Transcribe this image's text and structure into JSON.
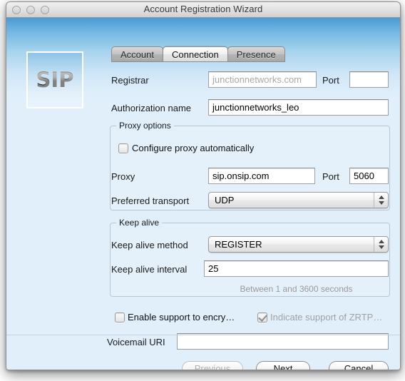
{
  "window": {
    "title": "Account Registration Wizard",
    "traffic_lights": [
      "close",
      "minimize",
      "zoom"
    ]
  },
  "branding": {
    "logo_text": "SIP"
  },
  "tabs": [
    {
      "label": "Account",
      "active": false
    },
    {
      "label": "Connection",
      "active": true
    },
    {
      "label": "Presence",
      "active": false
    }
  ],
  "form": {
    "registrar": {
      "label": "Registrar",
      "value": "",
      "placeholder": "junctionnetworks.com"
    },
    "registrar_port": {
      "label": "Port",
      "value": ""
    },
    "authorization_name": {
      "label": "Authorization name",
      "value": "junctionnetworks_leo"
    },
    "voicemail_uri": {
      "label": "Voicemail URI",
      "value": ""
    }
  },
  "proxy_options": {
    "title": "Proxy options",
    "configure_automatically": {
      "label": "Configure proxy automatically",
      "checked": false
    },
    "proxy": {
      "label": "Proxy",
      "value": "sip.onsip.com"
    },
    "proxy_port": {
      "label": "Port",
      "value": "5060"
    },
    "preferred_transport": {
      "label": "Preferred transport",
      "value": "UDP"
    }
  },
  "keep_alive": {
    "title": "Keep alive",
    "method": {
      "label": "Keep alive method",
      "value": "REGISTER"
    },
    "interval": {
      "label": "Keep alive interval",
      "value": "25"
    },
    "hint": "Between 1 and 3600 seconds"
  },
  "encryption": {
    "enable_encryption": {
      "label": "Enable support to encry…",
      "checked": false,
      "disabled": false
    },
    "indicate_zrtp": {
      "label": "Indicate support of ZRTP…",
      "checked": true,
      "disabled": true
    }
  },
  "buttons": {
    "previous": {
      "label": "Previous",
      "disabled": true
    },
    "next": {
      "label": "Next",
      "disabled": false
    },
    "cancel": {
      "label": "Cancel",
      "disabled": false
    }
  },
  "colors": {
    "window_chrome": "#e2e2e2",
    "body_top": "#4a9bd8",
    "body_bottom": "#e1effb",
    "field_border": "#a0a0a0",
    "group_border": "#b7c6d3",
    "disabled_text": "#a2a2a2"
  }
}
